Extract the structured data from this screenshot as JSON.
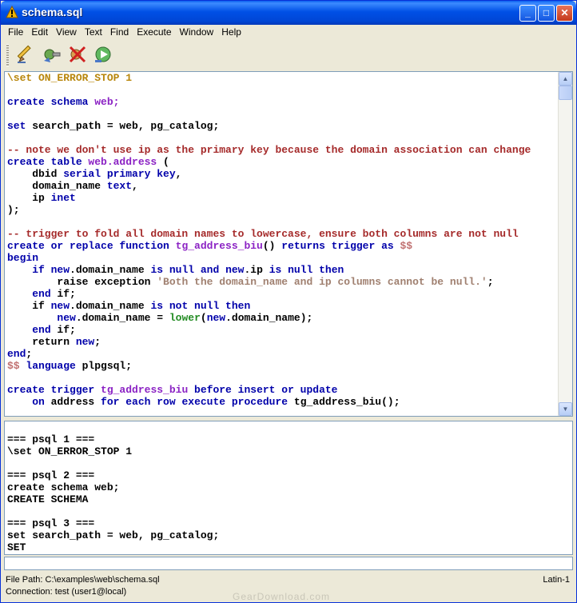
{
  "window": {
    "title": "schema.sql"
  },
  "title_buttons": {
    "minimize": "_",
    "maximize": "□",
    "close": "✕"
  },
  "menu": [
    "File",
    "Edit",
    "View",
    "Text",
    "Find",
    "Execute",
    "Window",
    "Help"
  ],
  "toolbar": {
    "tools": [
      "edit-icon",
      "connect-icon",
      "disconnect-icon",
      "execute-icon"
    ]
  },
  "editor_lines": [
    [
      {
        "t": "\\set ON_ERROR_STOP 1",
        "c": "pp"
      }
    ],
    [],
    [
      {
        "t": "create schema ",
        "c": "kw"
      },
      {
        "t": "web;",
        "c": "id"
      }
    ],
    [],
    [
      {
        "t": "set",
        "c": "kw"
      },
      {
        "t": " search_path = web, pg_catalog;"
      }
    ],
    [],
    [
      {
        "t": "-- note we don't use ip as the primary key because the domain association can change",
        "c": "cm"
      }
    ],
    [
      {
        "t": "create table ",
        "c": "kw"
      },
      {
        "t": "web.address",
        "c": "id"
      },
      {
        "t": " ("
      }
    ],
    [
      {
        "t": "    dbid "
      },
      {
        "t": "serial primary key",
        "c": "kw"
      },
      {
        "t": ","
      }
    ],
    [
      {
        "t": "    domain_name "
      },
      {
        "t": "text",
        "c": "kw"
      },
      {
        "t": ","
      }
    ],
    [
      {
        "t": "    ip "
      },
      {
        "t": "inet",
        "c": "kw"
      }
    ],
    [
      {
        "t": ");"
      }
    ],
    [],
    [
      {
        "t": "-- trigger to fold all domain names to lowercase, ensure both columns are not null",
        "c": "cm"
      }
    ],
    [
      {
        "t": "create or replace function ",
        "c": "kw"
      },
      {
        "t": "tg_address_biu",
        "c": "id"
      },
      {
        "t": "() "
      },
      {
        "t": "returns trigger as ",
        "c": "kw"
      },
      {
        "t": "$$",
        "c": "dl"
      }
    ],
    [
      {
        "t": "begin",
        "c": "kw"
      }
    ],
    [
      {
        "t": "    "
      },
      {
        "t": "if new",
        "c": "kw"
      },
      {
        "t": ".domain_name "
      },
      {
        "t": "is null and new",
        "c": "kw"
      },
      {
        "t": ".ip "
      },
      {
        "t": "is null then",
        "c": "kw"
      }
    ],
    [
      {
        "t": "        raise exception "
      },
      {
        "t": "'Both the domain_name and ip columns cannot be null.'",
        "c": "st"
      },
      {
        "t": ";"
      }
    ],
    [
      {
        "t": "    "
      },
      {
        "t": "end",
        "c": "kw"
      },
      {
        "t": " if;"
      }
    ],
    [
      {
        "t": "    if "
      },
      {
        "t": "new",
        "c": "kw"
      },
      {
        "t": ".domain_name "
      },
      {
        "t": "is not null then",
        "c": "kw"
      }
    ],
    [
      {
        "t": "        "
      },
      {
        "t": "new",
        "c": "kw"
      },
      {
        "t": ".domain_name = "
      },
      {
        "t": "lower",
        "c": "fn"
      },
      {
        "t": "("
      },
      {
        "t": "new",
        "c": "kw"
      },
      {
        "t": ".domain_name);"
      }
    ],
    [
      {
        "t": "    "
      },
      {
        "t": "end",
        "c": "kw"
      },
      {
        "t": " if;"
      }
    ],
    [
      {
        "t": "    return "
      },
      {
        "t": "new",
        "c": "kw"
      },
      {
        "t": ";"
      }
    ],
    [
      {
        "t": "end",
        "c": "kw"
      },
      {
        "t": ";"
      }
    ],
    [
      {
        "t": "$$",
        "c": "dl"
      },
      {
        "t": " language ",
        "c": "kw"
      },
      {
        "t": "plpgsql;"
      }
    ],
    [],
    [
      {
        "t": "create trigger ",
        "c": "kw"
      },
      {
        "t": "tg_address_biu",
        "c": "id"
      },
      {
        "t": " before insert or update",
        "c": "kw"
      }
    ],
    [
      {
        "t": "    "
      },
      {
        "t": "on",
        "c": "kw"
      },
      {
        "t": " address "
      },
      {
        "t": "for each row execute procedure",
        "c": "kw"
      },
      {
        "t": " tg_address_biu();"
      }
    ]
  ],
  "output_text": "\n=== psql 1 ===\n\\set ON_ERROR_STOP 1\n\n=== psql 2 ===\ncreate schema web;\nCREATE SCHEMA\n\n=== psql 3 ===\nset search_path = web, pg_catalog;\nSET",
  "command_input": {
    "value": ""
  },
  "status": {
    "file_path": "File Path: C:\\examples\\web\\schema.sql",
    "connection": "Connection: test (user1@local)",
    "encoding": "Latin-1"
  },
  "watermark": "GearDownload.com"
}
